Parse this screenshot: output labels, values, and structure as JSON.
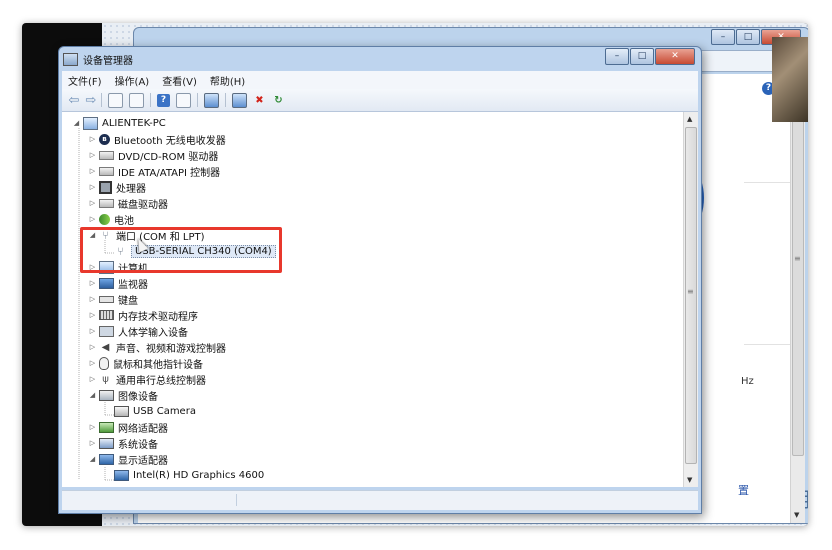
{
  "window": {
    "title": "设备管理器",
    "controls": {
      "minimize": "–",
      "maximize": "□",
      "close": "✕"
    }
  },
  "back_window": {
    "controls": {
      "minimize": "–",
      "maximize": "□",
      "close": "✕"
    },
    "search_icon": "search-icon",
    "help": "?",
    "partial_text": {
      "hz": "Hz",
      "link": "置",
      "big": "用"
    }
  },
  "menu": [
    {
      "label": "文件(F)"
    },
    {
      "label": "操作(A)"
    },
    {
      "label": "查看(V)"
    },
    {
      "label": "帮助(H)"
    }
  ],
  "toolbar": {
    "back_glyph": "⇦",
    "forward_glyph": "⇨",
    "info_glyph": "?",
    "uninstall_glyph": "✖",
    "update_glyph": "↻"
  },
  "tree": {
    "root": {
      "label": "ALIENTEK-PC",
      "icon": "computer-icon"
    },
    "nodes": [
      {
        "label": "Bluetooth 无线电收发器",
        "icon": "bluetooth-icon",
        "glyph": "ʙ",
        "expanded": false
      },
      {
        "label": "DVD/CD-ROM 驱动器",
        "icon": "dvd-drive-icon",
        "expanded": false
      },
      {
        "label": "IDE ATA/ATAPI 控制器",
        "icon": "ide-controller-icon",
        "expanded": false
      },
      {
        "label": "处理器",
        "icon": "processor-icon",
        "expanded": false
      },
      {
        "label": "磁盘驱动器",
        "icon": "disk-drive-icon",
        "expanded": false
      },
      {
        "label": "电池",
        "icon": "battery-icon",
        "expanded": false
      },
      {
        "label": "端口 (COM 和 LPT)",
        "icon": "port-icon",
        "glyph": "⑂",
        "expanded": true,
        "children": [
          {
            "label": "USB-SERIAL CH340 (COM4)",
            "icon": "serial-port-icon",
            "glyph": "⑂"
          }
        ]
      },
      {
        "label": "计算机",
        "icon": "computer-icon",
        "expanded": false
      },
      {
        "label": "监视器",
        "icon": "monitor-icon",
        "expanded": false
      },
      {
        "label": "键盘",
        "icon": "keyboard-icon",
        "expanded": false
      },
      {
        "label": "内存技术驱动程序",
        "icon": "memory-icon",
        "expanded": false
      },
      {
        "label": "人体学输入设备",
        "icon": "hid-icon",
        "expanded": false
      },
      {
        "label": "声音、视频和游戏控制器",
        "icon": "sound-icon",
        "glyph": "◀",
        "expanded": false
      },
      {
        "label": "鼠标和其他指针设备",
        "icon": "mouse-icon",
        "expanded": false
      },
      {
        "label": "通用串行总线控制器",
        "icon": "usb-icon",
        "glyph": "ψ",
        "expanded": false
      },
      {
        "label": "图像设备",
        "icon": "imaging-device-icon",
        "expanded": true,
        "children": [
          {
            "label": "USB Camera",
            "icon": "camera-icon"
          }
        ]
      },
      {
        "label": "网络适配器",
        "icon": "network-adapter-icon",
        "expanded": false
      },
      {
        "label": "系统设备",
        "icon": "system-device-icon",
        "expanded": false
      },
      {
        "label": "显示适配器",
        "icon": "display-adapter-icon",
        "expanded": true,
        "children": [
          {
            "label": "Intel(R) HD Graphics 4600",
            "icon": "display-adapter-icon"
          }
        ]
      }
    ],
    "expander": {
      "collapsed": "▷",
      "expanded": "◢"
    }
  },
  "scrollbar": {
    "up": "▲",
    "down": "▼",
    "grip": "≡"
  },
  "highlight": {
    "color": "#e8382c",
    "target": "port-node"
  }
}
